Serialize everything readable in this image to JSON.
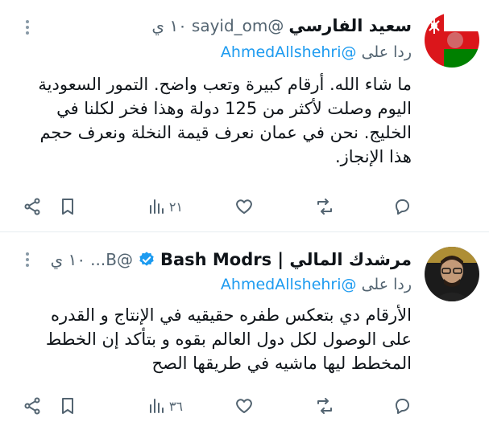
{
  "tweets": [
    {
      "name": "سعيد الفارسي",
      "handle": "@sayid_om",
      "time": "١٠ ي",
      "reply_prefix": "ردا على",
      "reply_to": "@AhmedAllshehri",
      "text": "ما شاء الله. أرقام كبيرة وتعب واضح. التمور السعودية\nاليوم وصلت لأكثر من 125 دولة وهذا فخر لكلنا في\nالخليج. نحن في عمان نعرف قيمة النخلة ونعرف حجم\nهذا الإنجاز.",
      "views": "٢١",
      "avatar_icon": "oman-emblem-icon"
    },
    {
      "name": "مرشدك المالي | Bash Modrs",
      "handle": "@B...",
      "time": "١٠ ي",
      "reply_prefix": "ردا على",
      "reply_to": "@AhmedAllshehri",
      "text": "الأرقام دي بتعكس طفره حقيقيه في الإنتاج و القدره\nعلى الوصول لكل دول العالم بقوه و بتأكد إن الخطط\nالمخطط ليها ماشيه في طريقها الصح",
      "views": "٣٦",
      "verified": true,
      "avatar_icon": "person-photo-avatar"
    }
  ],
  "colors": {
    "accent": "#1d9bf0",
    "muted": "#536471",
    "text": "#0f1419"
  }
}
